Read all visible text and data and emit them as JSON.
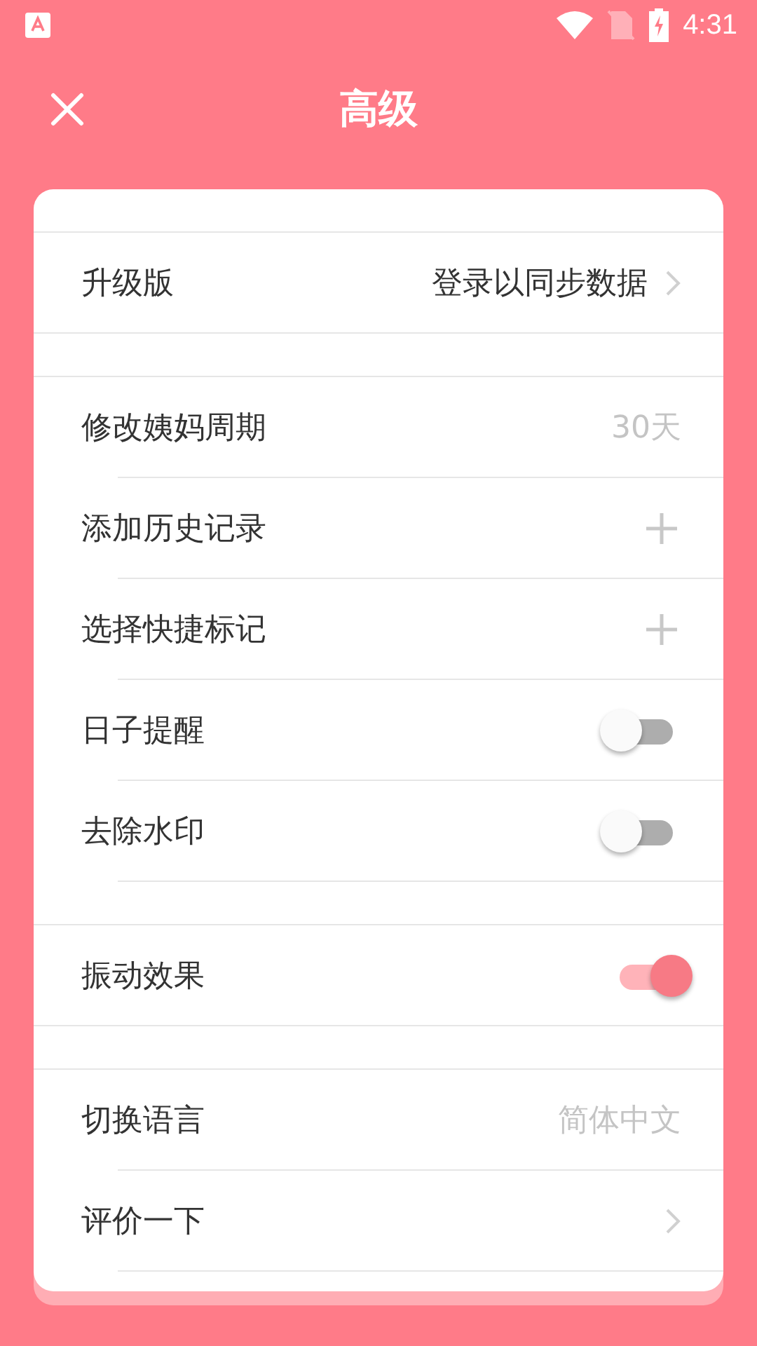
{
  "status_bar": {
    "time": "4:31"
  },
  "header": {
    "title": "高级"
  },
  "sections": [
    {
      "rows": [
        {
          "kind": "link",
          "label": "升级版",
          "value": "登录以同步数据",
          "chevron": true
        }
      ]
    },
    {
      "rows": [
        {
          "kind": "link",
          "label": "修改姨妈周期",
          "value": "30天",
          "chevron": false
        },
        {
          "kind": "add",
          "label": "添加历史记录"
        },
        {
          "kind": "add",
          "label": "选择快捷标记"
        },
        {
          "kind": "toggle",
          "label": "日子提醒",
          "on": false
        },
        {
          "kind": "toggle",
          "label": "去除水印",
          "on": false
        }
      ]
    },
    {
      "rows": [
        {
          "kind": "toggle",
          "label": "振动效果",
          "on": true
        }
      ]
    },
    {
      "rows": [
        {
          "kind": "link",
          "label": "切换语言",
          "value": "简体中文",
          "chevron": false
        },
        {
          "kind": "link",
          "label": "评价一下",
          "chevron": true
        }
      ]
    }
  ]
}
